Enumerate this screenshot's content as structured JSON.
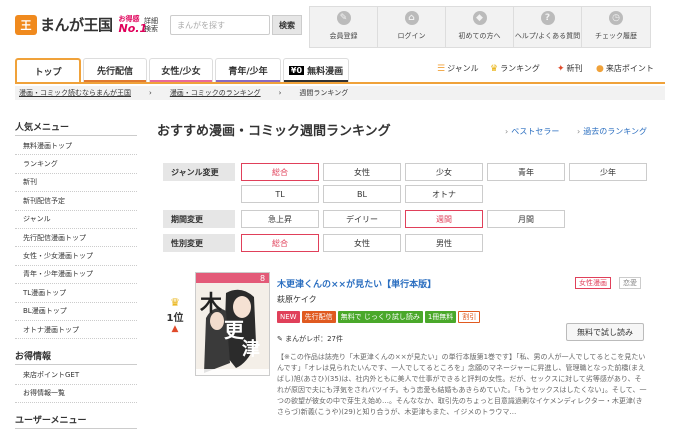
{
  "header": {
    "logo_text": "まんが王国",
    "logo_badge_top": "お得感",
    "logo_badge_bottom": "No.1",
    "advanced_search": "詳細検索",
    "search_placeholder": "まんがを探す",
    "search_button": "検索",
    "nav": [
      {
        "label": "会員登録",
        "icon": "pencil-icon",
        "glyph": "✎"
      },
      {
        "label": "ログイン",
        "icon": "lock-icon",
        "glyph": "⌂"
      },
      {
        "label": "初めての方へ",
        "icon": "beginner-icon",
        "glyph": "◆"
      },
      {
        "label": "ヘルプ/よくある質問",
        "icon": "help-icon",
        "glyph": "?"
      },
      {
        "label": "チェック履歴",
        "icon": "clock-icon",
        "glyph": "◷"
      }
    ]
  },
  "tabs": [
    {
      "label": "トップ",
      "color": "#f0a23a"
    },
    {
      "label": "先行配信",
      "color": "#e07a30"
    },
    {
      "label": "女性/少女",
      "color": "#e86a9a"
    },
    {
      "label": "青年/少年",
      "color": "#8a6ac0"
    },
    {
      "badge": "¥0",
      "label": "無料漫画",
      "color": "#333333"
    }
  ],
  "right_nav": [
    {
      "label": "ジャンル",
      "icon": "list-icon",
      "glyph": "☰",
      "color": "#f0a23a"
    },
    {
      "label": "ランキング",
      "icon": "crown-icon",
      "glyph": "♛",
      "color": "#e8b00a"
    },
    {
      "label": "新刊",
      "icon": "new-icon",
      "glyph": "✦",
      "color": "#e04a2a"
    },
    {
      "label": "来店ポイント",
      "icon": "point-icon",
      "glyph": "●",
      "color": "#f0a23a"
    }
  ],
  "breadcrumb": [
    "漫画・コミック読むならまんが王国",
    "漫画・コミックのランキング",
    "週間ランキング"
  ],
  "sidebar": {
    "section1": "人気メニュー",
    "items1": [
      "無料漫画トップ",
      "ランキング",
      "新刊",
      "新刊配信予定",
      "ジャンル",
      "先行配信漫画トップ",
      "女性・少女漫画トップ",
      "青年・少年漫画トップ",
      "TL漫画トップ",
      "BL漫画トップ",
      "オトナ漫画トップ"
    ],
    "section2": "お得情報",
    "items2": [
      "来店ポイントGET",
      "お得情報一覧"
    ],
    "section3": "ユーザーメニュー"
  },
  "main": {
    "title": "おすすめ漫画・コミック週間ランキング",
    "link_bestseller": "ベストセラー",
    "link_past": "過去のランキング",
    "filters": {
      "genre_label": "ジャンル変更",
      "genre_row1": [
        "総合",
        "女性",
        "少女",
        "青年",
        "少年"
      ],
      "genre_row2": [
        "TL",
        "BL",
        "オトナ"
      ],
      "period_label": "期間変更",
      "period": [
        "急上昇",
        "デイリー",
        "週間",
        "月間"
      ],
      "gender_label": "性別変更",
      "gender": [
        "総合",
        "女性",
        "男性"
      ]
    },
    "item": {
      "rank": "1位",
      "title": "木更津くんの××が見たい【単行本版】",
      "author": "萩原ケイク",
      "genre_tags": [
        "女性漫画",
        "恋愛"
      ],
      "badges": [
        {
          "label": "NEW",
          "color": "#e0405a"
        },
        {
          "label": "先行配信",
          "color": "#e05a20"
        },
        {
          "label": "無料で じっくり試し読み",
          "color": "#4aa82a"
        },
        {
          "label": "1冊無料",
          "color": "#4aa82a"
        },
        {
          "label": "割引",
          "color": "#ffffff"
        }
      ],
      "review": "まんがレポ：27件",
      "trial_button": "無料で試し読み",
      "cover_volume": "8",
      "description": "【※この作品は誌売り「木更津くんの××が見たい」の単行本版第1巻です】「私、男の人が一人でしてるとこを見たいんです」「オレは見られたいんです、一人でしてるところを」念願のマネージャーに昇進し、管理職となった前橋(まえばし)旭(あさひ)(35)は、社内外ともに美人で仕事ができると評判の女性。だが、セックスに対して劣等感があり、それが原因で夫にも浮気をされバツイチ。もう恋愛も結婚もあきらめていた。「もうセックスはしたくない」。そして、一つの欲望が彼女の中で芽生え始め…。そんななか、取引先のちょっと目意識過剰なイケメンディレクター・木更津(きさらづ)新義(こうや)(29)と知り合うが、木更津もまた、イジメのトラウマ…"
    }
  }
}
